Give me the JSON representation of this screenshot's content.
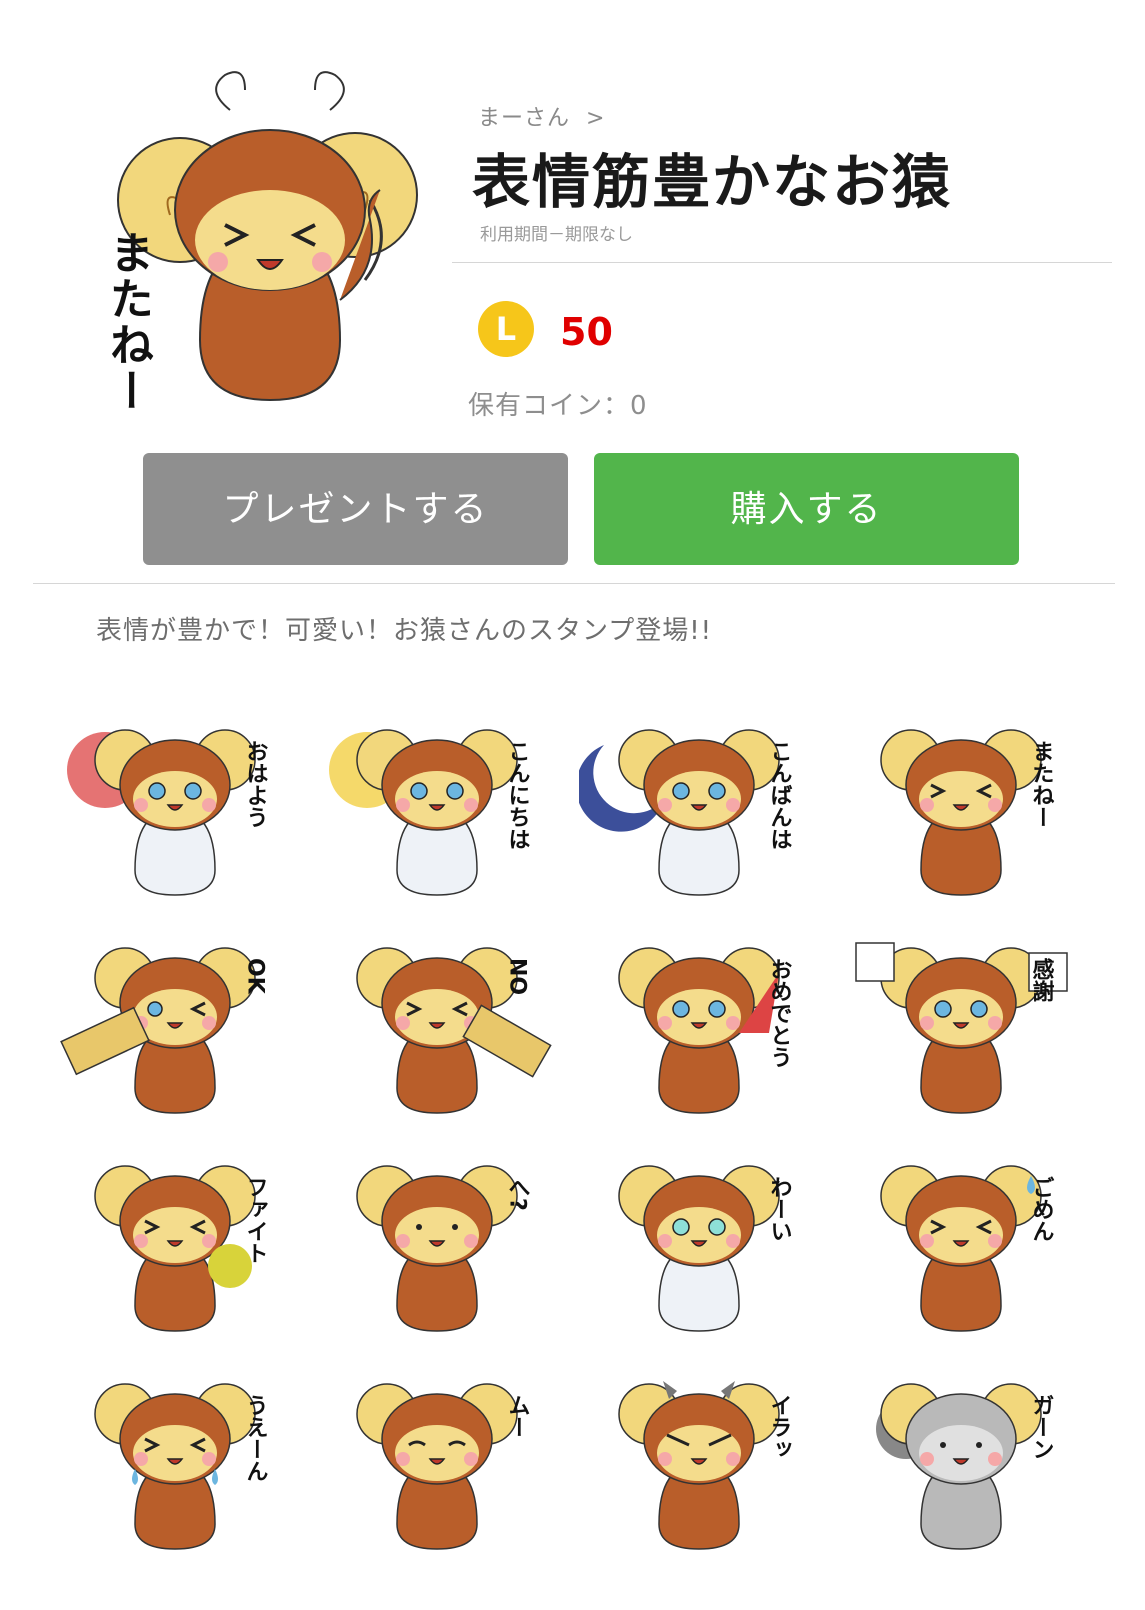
{
  "author": {
    "name": "まーさん",
    "chevron": ">"
  },
  "pack": {
    "title": "表情筋豊かなお猿",
    "validity": "利用期間－期限なし",
    "description": "表情が豊かで！可愛い！お猿さんのスタンプ登場!!"
  },
  "hero": {
    "caption": "またねー"
  },
  "pricing": {
    "coin_symbol": "L",
    "price": "50",
    "owned_coins": "保有コイン：0",
    "price_color": "#e00000",
    "coin_color": "#f6c61a"
  },
  "actions": {
    "present_label": "プレゼントする",
    "buy_label": "購入する",
    "present_color": "#8f8f8f",
    "buy_color": "#52b54b"
  },
  "stickers": [
    {
      "caption": "おはよう",
      "shirt": true,
      "prop": "sun-red",
      "expression": "happy",
      "color": "#b95e2a"
    },
    {
      "caption": "こんにちは",
      "shirt": true,
      "prop": "sun-yellow",
      "expression": "happy",
      "color": "#b95e2a"
    },
    {
      "caption": "こんばんは",
      "shirt": true,
      "prop": "moon",
      "expression": "happy",
      "color": "#b95e2a"
    },
    {
      "caption": "またねー",
      "shirt": false,
      "prop": "none",
      "expression": "squint",
      "color": "#b95e2a"
    },
    {
      "caption": "OK",
      "shirt": false,
      "prop": "sign-ok",
      "expression": "wink",
      "color": "#b95e2a"
    },
    {
      "caption": "NO",
      "shirt": false,
      "prop": "sign-no",
      "expression": "squint",
      "color": "#b95e2a"
    },
    {
      "caption": "おめでとう",
      "shirt": false,
      "prop": "party-popper",
      "expression": "happy",
      "color": "#b95e2a"
    },
    {
      "caption": "感謝",
      "shirt": false,
      "prop": "flags",
      "expression": "happy",
      "color": "#b95e2a"
    },
    {
      "caption": "ファイト",
      "shirt": false,
      "prop": "pompom",
      "expression": "squint",
      "color": "#b95e2a"
    },
    {
      "caption": "へ?",
      "shirt": false,
      "prop": "none",
      "expression": "blank",
      "color": "#b95e2a"
    },
    {
      "caption": "わーい",
      "shirt": true,
      "prop": "none",
      "expression": "excited",
      "color": "#b95e2a"
    },
    {
      "caption": "ごめん",
      "shirt": false,
      "prop": "sweat",
      "expression": "squint",
      "color": "#b95e2a"
    },
    {
      "caption": "うえーん",
      "shirt": false,
      "prop": "tears",
      "expression": "cry",
      "color": "#b95e2a"
    },
    {
      "caption": "ムー",
      "shirt": false,
      "prop": "none",
      "expression": "pout",
      "color": "#b95e2a"
    },
    {
      "caption": "イラッ",
      "shirt": false,
      "prop": "horns",
      "expression": "angry",
      "color": "#b95e2a"
    },
    {
      "caption": "ガーン",
      "shirt": false,
      "prop": "gloom",
      "expression": "blank",
      "color": "#b9b9b9"
    }
  ]
}
